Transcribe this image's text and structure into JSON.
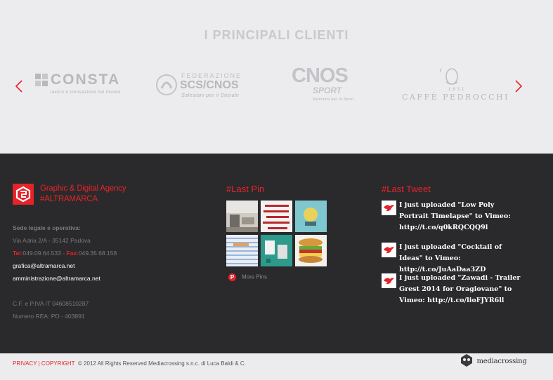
{
  "clients": {
    "title": "I PRINCIPALI CLIENTI",
    "logos": [
      {
        "big": "CONSTA",
        "small": "lavoro e innovazione nel mondo"
      },
      {
        "big": "SCS/CNOS",
        "top": "FEDERAZIONE",
        "small": "Salesiani per il Sociale"
      },
      {
        "big": "CNOS",
        "sub": "SPORT",
        "small": "Salesiani per lo Sport"
      },
      {
        "big": "CAFFÈ PEDROCCHI",
        "small": "1831"
      }
    ]
  },
  "brand": {
    "line1": "Graphic & Digital Agency",
    "line2": "#ALTRAMARCA"
  },
  "contact": {
    "heading": "Sede legale e operativa:",
    "address": "Via Adria 2/A - 35142 Padova",
    "tel_label": "Tel:",
    "tel": "049.09.64.533",
    "fax_label": " - Fax:",
    "fax": "049.35.68.158",
    "email1": "grafica@altramarca.net",
    "email2": "amministrazione@altramarca.net",
    "vat": "C.F. e P.IVA IT 04608510287",
    "rea": "Numero REA: PD - 403891"
  },
  "pins": {
    "title": "#Last Pin",
    "more_label": "More Pins",
    "more_icon": "P"
  },
  "tweets": {
    "title": "#Last Tweet",
    "items": [
      "I just uploaded \"Low Poly Portrait Timelapse\" to Vimeo: http://t.co/q0kRQCQQ9l",
      "I just uploaded \"Cocktail of Ideas\" to Vimeo: http://t.co/JuAaDaa3ZD",
      "I just uploaded \"Zawadi - Trailer Grest 2014 for Oragiovane\" to Vimeo: http://t.co/lioFJYR6ll"
    ]
  },
  "bottom": {
    "privacy": "PRIVACY",
    "sep": " | ",
    "copyright": "COPYRIGHT",
    "rights": "© 2012 All Rights Reserved Mediacrossing s.n.c. di Luca Baldi & C.",
    "partner": "mediacrossing"
  },
  "colors": {
    "accent": "#e52329",
    "footer_bg": "#2a2a2c",
    "page_bg": "#ececee"
  }
}
